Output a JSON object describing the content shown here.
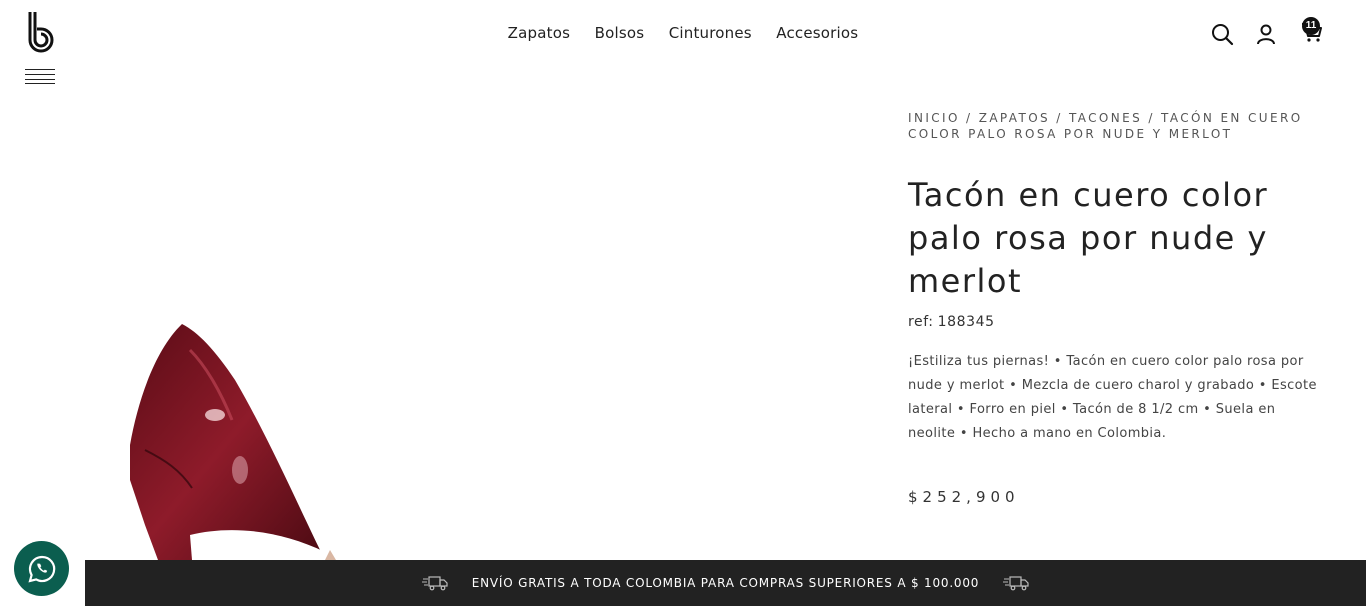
{
  "header": {
    "logo_text": "b",
    "nav": [
      "Zapatos",
      "Bolsos",
      "Cinturones",
      "Accesorios"
    ],
    "cart_count": "11",
    "icons": {
      "menu": "hamburger-menu-icon",
      "search": "search-icon",
      "account": "user-icon",
      "cart": "cart-icon"
    }
  },
  "product": {
    "breadcrumb": [
      "INICIO",
      "ZAPATOS",
      "TACONES",
      "TACÓN EN CUERO COLOR PALO ROSA POR NUDE Y MERLOT"
    ],
    "breadcrumb_separator": " / ",
    "title": "Tacón en cuero color palo rosa por nude y merlot",
    "ref_label": "ref:",
    "ref_value": "188345",
    "description": "¡Estiliza tus piernas! • Tacón en cuero color palo rosa por nude y merlot • Mezcla de cuero charol y grabado • Escote lateral • Forro en piel • Tacón de 8 1/2 cm • Suela en neolite • Hecho a mano en Colombia.",
    "price": "$252,900",
    "image_alt": "shoe-image"
  },
  "shipping_bar": {
    "text": "ENVÍO GRATIS A TODA COLOMBIA PARA COMPRAS SUPERIORES A $ 100.000",
    "icon": "truck-icon"
  },
  "whatsapp": {
    "icon": "whatsapp-icon"
  },
  "colors": {
    "shoe": "#7a1420",
    "bar": "#222222",
    "whatsapp": "#0b5e4f"
  }
}
